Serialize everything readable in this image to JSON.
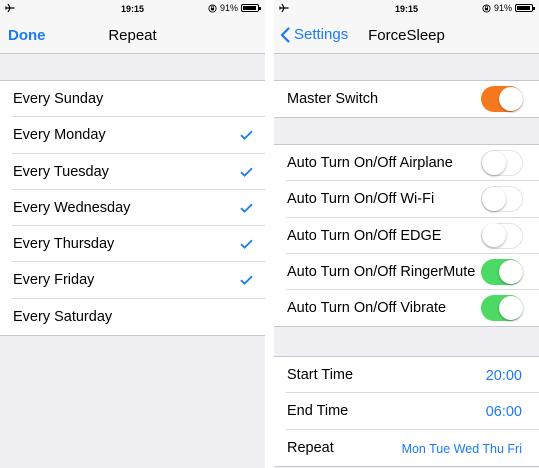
{
  "status_bar": {
    "time": "19:15",
    "battery": "91%",
    "battery_level": 0.91
  },
  "left": {
    "nav": {
      "done_label": "Done",
      "title": "Repeat"
    },
    "days": [
      {
        "label": "Every Sunday",
        "checked": false
      },
      {
        "label": "Every Monday",
        "checked": true
      },
      {
        "label": "Every Tuesday",
        "checked": true
      },
      {
        "label": "Every Wednesday",
        "checked": true
      },
      {
        "label": "Every Thursday",
        "checked": true
      },
      {
        "label": "Every Friday",
        "checked": true
      },
      {
        "label": "Every Saturday",
        "checked": false
      }
    ]
  },
  "right": {
    "nav": {
      "back_label": "Settings",
      "title": "ForceSleep"
    },
    "master": {
      "label": "Master Switch",
      "on": true,
      "color": "#f7791e"
    },
    "toggles": [
      {
        "label": "Auto Turn On/Off Airplane",
        "on": false
      },
      {
        "label": "Auto Turn On/Off Wi-Fi",
        "on": false
      },
      {
        "label": "Auto Turn On/Off EDGE",
        "on": false
      },
      {
        "label": "Auto Turn On/Off RingerMute",
        "on": true
      },
      {
        "label": "Auto Turn On/Off Vibrate",
        "on": true
      }
    ],
    "toggle_on_color": "#4cd964",
    "schedule": {
      "start_label": "Start Time",
      "start_value": "20:00",
      "end_label": "End Time",
      "end_value": "06:00",
      "repeat_label": "Repeat",
      "repeat_value": "Mon Tue Wed Thu Fri"
    }
  },
  "colors": {
    "accent": "#1a7bf2",
    "background": "#efeff4"
  },
  "icons": [
    "airplane-icon",
    "rotation-lock-icon",
    "battery-icon",
    "checkmark-icon",
    "back-chevron-icon"
  ]
}
